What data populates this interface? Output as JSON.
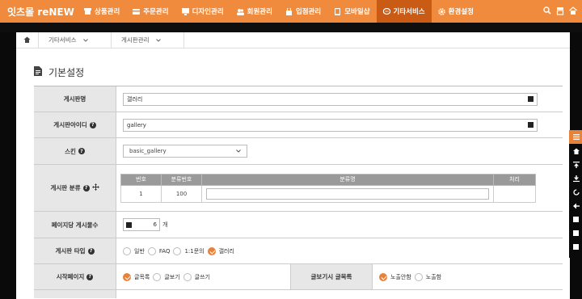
{
  "app": {
    "logo": "잇츠몰 reNEW"
  },
  "nav": {
    "items": [
      {
        "label": "상품관리",
        "icon": "box-icon"
      },
      {
        "label": "주문관리",
        "icon": "card-icon"
      },
      {
        "label": "디자인관리",
        "icon": "monitor-icon"
      },
      {
        "label": "회원관리",
        "icon": "users-icon"
      },
      {
        "label": "입점관리",
        "icon": "store-icon"
      },
      {
        "label": "모바일샵",
        "icon": "tablet-icon"
      },
      {
        "label": "기타서비스",
        "icon": "chat-icon",
        "active": true
      },
      {
        "label": "환경설정",
        "icon": "gear-icon"
      }
    ],
    "tools": [
      "search-icon",
      "shop-icon",
      "home-icon"
    ]
  },
  "breadcrumb": {
    "level1": "기타서비스",
    "level2": "게시판관리"
  },
  "section": {
    "title": "기본설정"
  },
  "form": {
    "board_name": {
      "label": "게시판명",
      "value": "갤러리"
    },
    "board_id": {
      "label": "게시판아이디",
      "value": "gallery"
    },
    "skin": {
      "label": "스킨",
      "value": "basic_gallery"
    },
    "category": {
      "label": "게시판 분류",
      "headers": [
        "번호",
        "분류번호",
        "분류명",
        "처리"
      ],
      "rows": [
        {
          "no": "1",
          "code": "100",
          "name": "",
          "action": ""
        }
      ]
    },
    "per_page": {
      "label": "페이지당 게시물수",
      "value": "6",
      "unit": "개"
    },
    "board_type": {
      "label": "게시판 타입",
      "options": [
        "일반",
        "FAQ",
        "1:1문의",
        "갤러리"
      ],
      "selected": "갤러리"
    },
    "start_page": {
      "label": "시작페이지",
      "options": [
        "글목록",
        "글보기",
        "글쓰기"
      ],
      "selected": "글목록"
    },
    "view_list": {
      "label": "글보기시 글목록",
      "options": [
        "노출안함",
        "노출함"
      ],
      "selected": "노출안함"
    }
  },
  "colors": {
    "nav_bg": "#f08a3c",
    "nav_active": "#c95b14",
    "accent": "#e8813a"
  }
}
